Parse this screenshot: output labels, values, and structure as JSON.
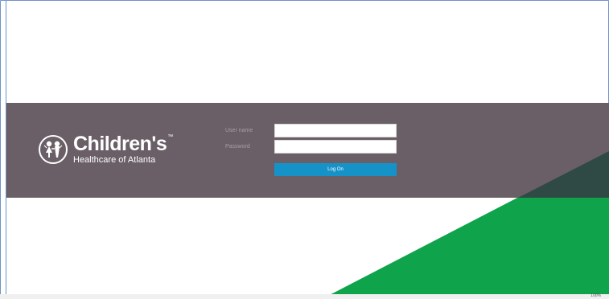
{
  "brand": {
    "name": "Children's",
    "trademark": "™",
    "subtitle": "Healthcare of Atlanta"
  },
  "login": {
    "username_label": "User name",
    "username_value": "",
    "password_label": "Password",
    "password_value": "",
    "submit_label": "Log On"
  },
  "statusbar": {
    "zoom": "100%"
  },
  "colors": {
    "band": "#6a5f66",
    "accent_green": "#0fa34b",
    "button_blue": "#1593c8",
    "frame_border": "#6f93c9"
  }
}
